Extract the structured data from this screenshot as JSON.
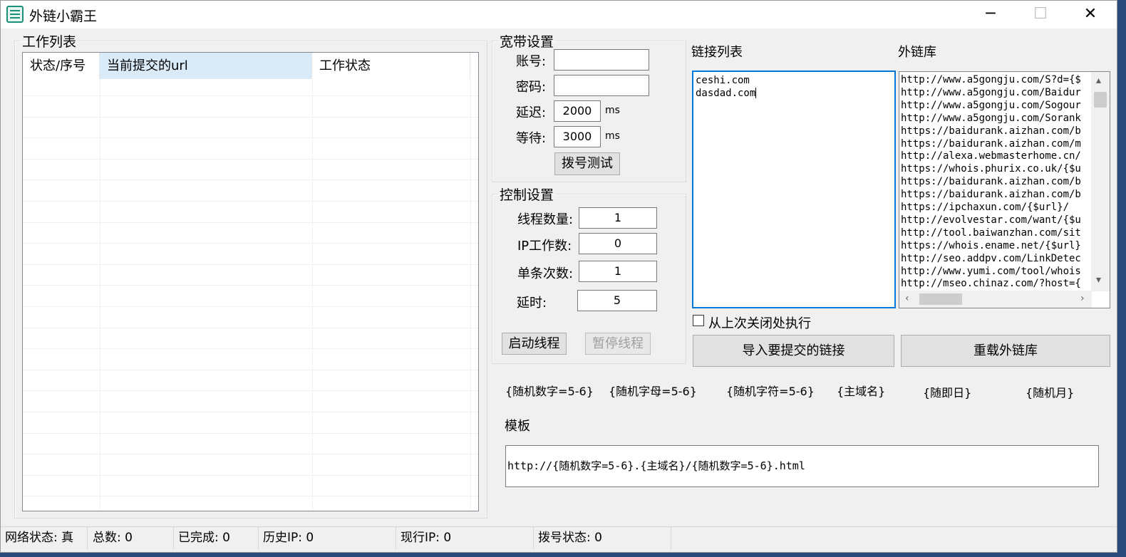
{
  "window": {
    "title": "外链小霸王",
    "minimize_glyph": "─",
    "maximize_glyph": "☐",
    "close_glyph": "✕"
  },
  "work_list": {
    "group_title": "工作列表",
    "columns": [
      "状态/序号",
      "当前提交的url",
      "工作状态"
    ]
  },
  "broadband": {
    "group_title": "宽带设置",
    "account_label": "账号:",
    "account_value": "",
    "password_label": "密码:",
    "password_value": "",
    "delay_label": "延迟:",
    "delay_value": "2000",
    "delay_unit": "ms",
    "wait_label": "等待:",
    "wait_value": "3000",
    "wait_unit": "ms",
    "dial_test_button": "拨号测试"
  },
  "control": {
    "group_title": "控制设置",
    "threads_label": "线程数量:",
    "threads_value": "1",
    "ip_work_label": "IP工作数:",
    "ip_work_value": "0",
    "single_count_label": "单条次数:",
    "single_count_value": "1",
    "timeout_label": "延时:",
    "timeout_value": "5",
    "start_button": "启动线程",
    "pause_button": "暂停线程"
  },
  "links": {
    "title": "链接列表",
    "content": [
      "ceshi.com",
      "dasdad.com"
    ]
  },
  "external": {
    "title": "外链库",
    "items": [
      "http://www.a5gongju.com/S?d={$",
      "http://www.a5gongju.com/Baidur",
      "http://www.a5gongju.com/Sogour",
      "http://www.a5gongju.com/Sorank",
      "https://baidurank.aizhan.com/b",
      "https://baidurank.aizhan.com/m",
      "http://alexa.webmasterhome.cn/",
      "https://whois.phurix.co.uk/{$u",
      "https://baidurank.aizhan.com/b",
      "https://baidurank.aizhan.com/b",
      "https://ipchaxun.com/{$url}/",
      "http://evolvestar.com/want/{$u",
      "http://tool.baiwanzhan.com/sit",
      "https://whois.ename.net/{$url}",
      "http://seo.addpv.com/LinkDetec",
      "http://www.yumi.com/tool/whois",
      "http://mseo.chinaz.com/?host={"
    ]
  },
  "resume_checkbox_label": "从上次关闭处执行",
  "import_button": "导入要提交的链接",
  "reload_button": "重载外链库",
  "tokens": [
    "{随机数字=5-6}",
    "{随机字母=5-6}",
    "{随机字符=5-6}",
    "{主域名}",
    "{随即日}",
    "{随机月}"
  ],
  "template": {
    "label": "模板",
    "value": "http://{随机数字=5-6}.{主域名}/{随机数字=5-6}.html"
  },
  "statusbar": {
    "net_status": "网络状态: 真",
    "total": "总数: 0",
    "done": "已完成: 0",
    "history_ip": "历史IP: 0",
    "current_ip": "现行IP: 0",
    "dial_status": "拨号状态: 0"
  }
}
